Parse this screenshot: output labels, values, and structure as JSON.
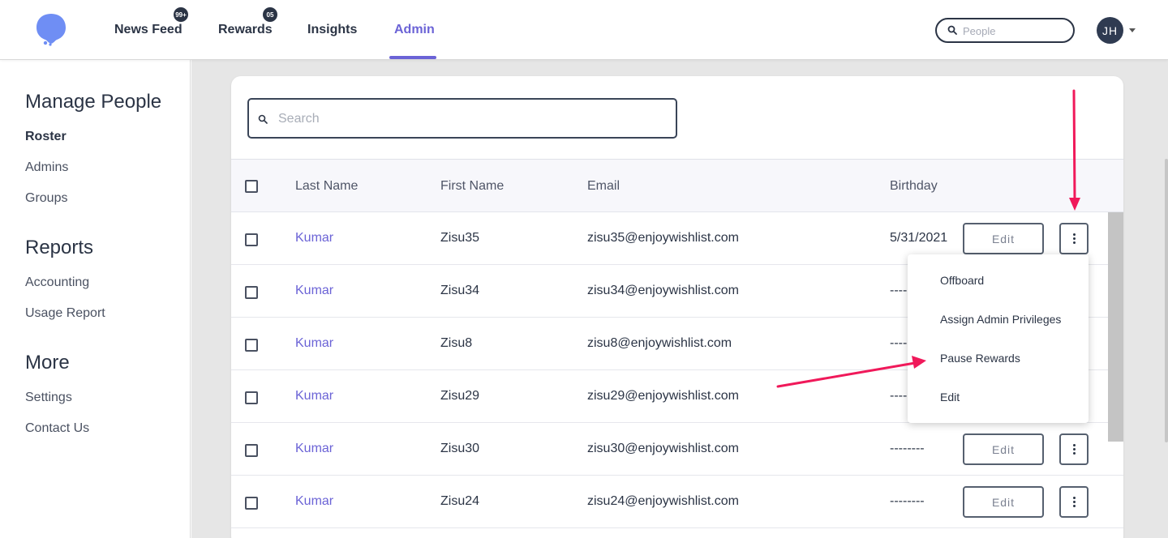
{
  "nav": {
    "items": [
      {
        "label": "News Feed",
        "badge": "99+"
      },
      {
        "label": "Rewards",
        "badge": "05"
      },
      {
        "label": "Insights"
      },
      {
        "label": "Admin"
      }
    ],
    "active_item": "Admin",
    "search_placeholder": "People",
    "avatar_initials": "JH",
    "accent_color": "#6b63d6"
  },
  "sidebar": {
    "sections": [
      {
        "title": "Manage People",
        "items": [
          "Roster",
          "Admins",
          "Groups"
        ]
      },
      {
        "title": "Reports",
        "items": [
          "Accounting",
          "Usage Report"
        ]
      },
      {
        "title": "More",
        "items": [
          "Settings",
          "Contact Us"
        ]
      }
    ],
    "active_item": "Roster"
  },
  "roster": {
    "search_placeholder": "Search",
    "columns": [
      "Last Name",
      "First Name",
      "Email",
      "Birthday"
    ],
    "edit_label": "Edit",
    "rows": [
      {
        "last_name": "Kumar",
        "first_name": "Zisu35",
        "email": "zisu35@enjoywishlist.com",
        "birthday": "5/31/2021"
      },
      {
        "last_name": "Kumar",
        "first_name": "Zisu34",
        "email": "zisu34@enjoywishlist.com",
        "birthday": "--------"
      },
      {
        "last_name": "Kumar",
        "first_name": "Zisu8",
        "email": "zisu8@enjoywishlist.com",
        "birthday": "--------"
      },
      {
        "last_name": "Kumar",
        "first_name": "Zisu29",
        "email": "zisu29@enjoywishlist.com",
        "birthday": "--------"
      },
      {
        "last_name": "Kumar",
        "first_name": "Zisu30",
        "email": "zisu30@enjoywishlist.com",
        "birthday": "--------"
      },
      {
        "last_name": "Kumar",
        "first_name": "Zisu24",
        "email": "zisu24@enjoywishlist.com",
        "birthday": "--------"
      }
    ]
  },
  "row_menu": {
    "items": [
      "Offboard",
      "Assign Admin Privileges",
      "Pause Rewards",
      "Edit"
    ]
  },
  "annotation_color": "#f0195a"
}
